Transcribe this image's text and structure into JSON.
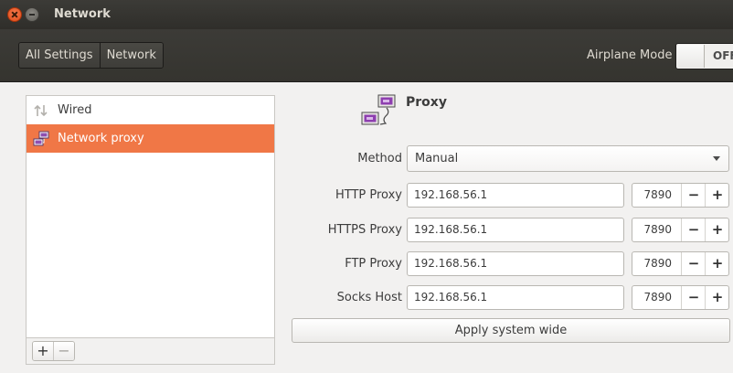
{
  "window": {
    "title": "Network"
  },
  "toolbar": {
    "breadcrumbs": [
      "All Settings",
      "Network"
    ],
    "airplane_mode_label": "Airplane Mode",
    "airplane_mode_state": "OFF"
  },
  "sidebar": {
    "items": [
      {
        "label": "Wired",
        "icon": "wired-icon",
        "selected": false
      },
      {
        "label": "Network proxy",
        "icon": "network-proxy-icon",
        "selected": true
      }
    ],
    "add_label": "+",
    "remove_label": "−"
  },
  "proxy": {
    "title": "Proxy",
    "method_label": "Method",
    "method_value": "Manual",
    "rows": [
      {
        "label": "HTTP Proxy",
        "host": "192.168.56.1",
        "port": "7890"
      },
      {
        "label": "HTTPS Proxy",
        "host": "192.168.56.1",
        "port": "7890"
      },
      {
        "label": "FTP Proxy",
        "host": "192.168.56.1",
        "port": "7890"
      },
      {
        "label": "Socks Host",
        "host": "192.168.56.1",
        "port": "7890"
      }
    ],
    "minus_label": "−",
    "plus_label": "+",
    "apply_label": "Apply system wide"
  },
  "colors": {
    "accent": "#f07746",
    "titlebar": "#3c3b37"
  }
}
